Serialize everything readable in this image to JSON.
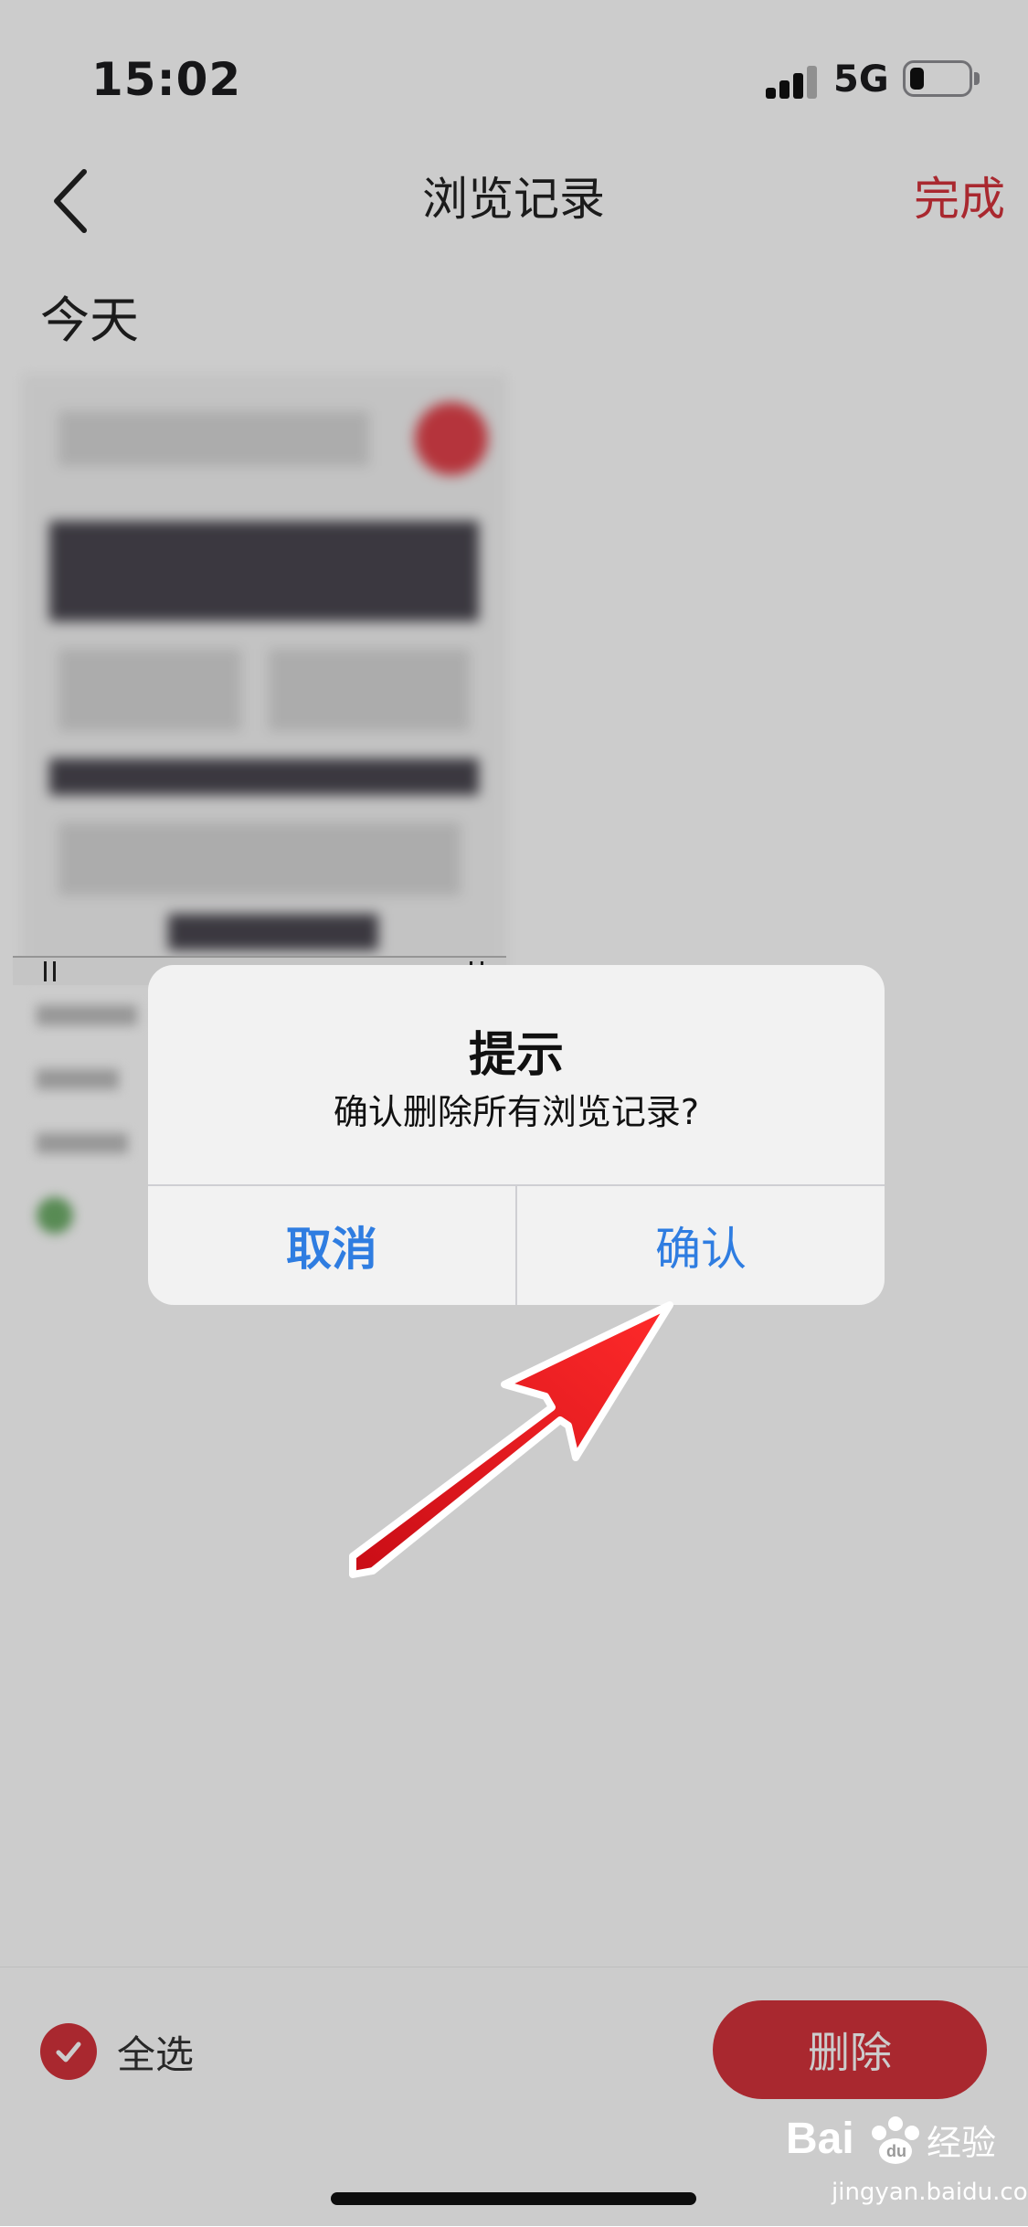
{
  "status_bar": {
    "time": "15:02",
    "network": "5G",
    "battery_level_percent": 25,
    "signal_icon": "cellular-signal-icon",
    "battery_icon": "battery-icon"
  },
  "nav": {
    "title": "浏览记录",
    "back_icon": "chevron-left-icon",
    "done_label": "完成"
  },
  "section_header": "今天",
  "bottom_bar": {
    "select_all_label": "全选",
    "select_all_checked": true,
    "delete_label": "删除"
  },
  "dialog": {
    "title": "提示",
    "message": "确认删除所有浏览记录?",
    "cancel_label": "取消",
    "confirm_label": "确认"
  },
  "watermark": {
    "logo_text": "Bai du 经验",
    "domain": "jingyan.baidu.com"
  },
  "colors": {
    "accent_red": "#d4323b",
    "ios_blue": "#2f7de1",
    "dim_overlay": "rgba(0,0,0,0.2)",
    "annotation_arrow": "#e8101a"
  }
}
